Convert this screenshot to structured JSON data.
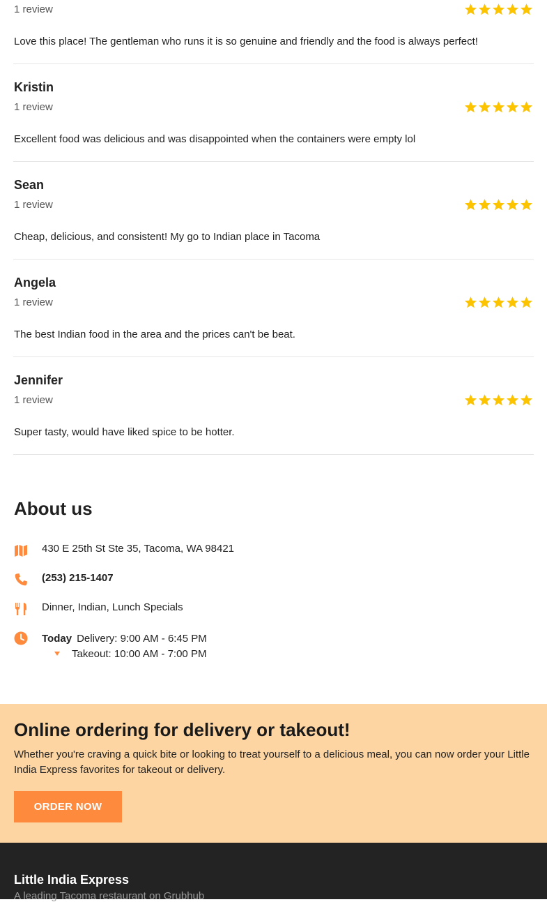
{
  "reviews": [
    {
      "name": "",
      "count": "1 review",
      "rating": 5,
      "text": "Love this place! The gentleman who runs it is so genuine and friendly and the food is always perfect!"
    },
    {
      "name": "Kristin",
      "count": "1 review",
      "rating": 5,
      "text": "Excellent food was delicious and was disappointed when the containers were empty lol"
    },
    {
      "name": "Sean",
      "count": "1 review",
      "rating": 5,
      "text": "Cheap, delicious, and consistent! My go to Indian place in Tacoma"
    },
    {
      "name": "Angela",
      "count": "1 review",
      "rating": 5,
      "text": "The best Indian food in the area and the prices can't be beat."
    },
    {
      "name": "Jennifer",
      "count": "1 review",
      "rating": 5,
      "text": "Super tasty, would have liked spice to be hotter."
    }
  ],
  "about": {
    "title": "About us",
    "address": "430 E 25th St Ste 35, Tacoma, WA 98421",
    "phone": "(253) 215-1407",
    "cuisines": "Dinner, Indian, Lunch Specials",
    "hours": {
      "today_label": "Today",
      "delivery": "Delivery: 9:00 AM - 6:45 PM",
      "takeout": "Takeout: 10:00 AM - 7:00 PM"
    }
  },
  "cta": {
    "title": "Online ordering for delivery or takeout!",
    "body": "Whether you're craving a quick bite or looking to treat yourself to a delicious meal, you can now order your Little India Express favorites for takeout or delivery.",
    "button_label": "ORDER NOW"
  },
  "footer": {
    "brand": "Little India Express",
    "tagline": "A leading Tacoma restaurant on Grubhub"
  },
  "colors": {
    "accent": "#fe8a3d",
    "star": "#fcc300",
    "cta_background": "#fdd5a3",
    "footer_background": "#232323"
  },
  "icons": [
    "star-icon",
    "map-icon",
    "phone-icon",
    "utensils-icon",
    "clock-icon",
    "caret-down-icon"
  ]
}
